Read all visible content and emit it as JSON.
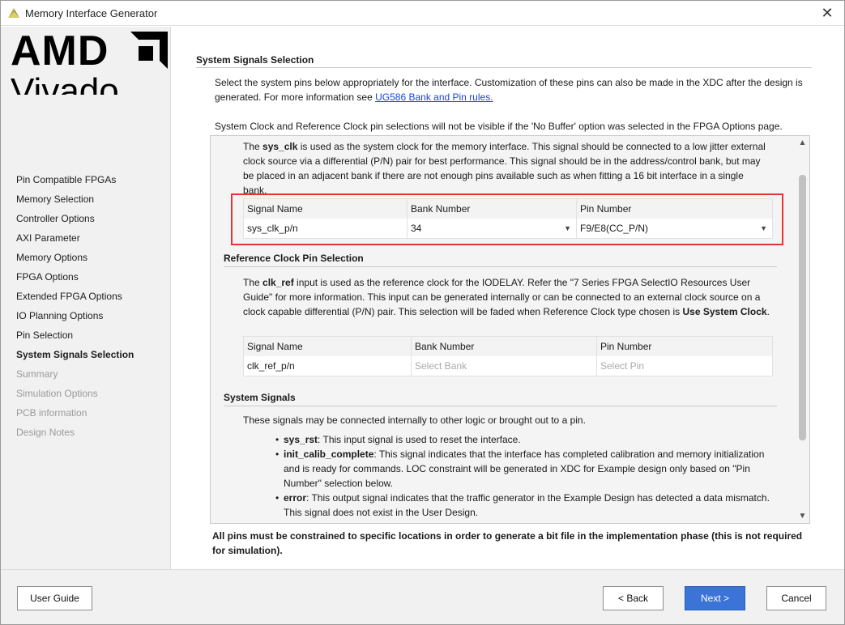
{
  "window": {
    "title": "Memory Interface Generator",
    "close_symbol": "✕"
  },
  "logo": {
    "brand": "AMD",
    "product": "Vivado"
  },
  "sidebar": {
    "steps": [
      {
        "label": "Pin Compatible FPGAs",
        "state": "normal"
      },
      {
        "label": "Memory Selection",
        "state": "normal"
      },
      {
        "label": "Controller Options",
        "state": "normal"
      },
      {
        "label": "AXI Parameter",
        "state": "normal"
      },
      {
        "label": "Memory Options",
        "state": "normal"
      },
      {
        "label": "FPGA Options",
        "state": "normal"
      },
      {
        "label": "Extended FPGA Options",
        "state": "normal"
      },
      {
        "label": "IO Planning Options",
        "state": "normal"
      },
      {
        "label": "Pin Selection",
        "state": "normal"
      },
      {
        "label": "System Signals Selection",
        "state": "active"
      },
      {
        "label": "Summary",
        "state": "disabled"
      },
      {
        "label": "Simulation Options",
        "state": "disabled"
      },
      {
        "label": "PCB information",
        "state": "disabled"
      },
      {
        "label": "Design Notes",
        "state": "disabled"
      }
    ]
  },
  "main": {
    "title": "System Signals Selection",
    "intro_text": "Select the system pins below appropriately for the interface. Customization of these pins can also be made in the XDC after the design is generated. For more information see",
    "intro_link": "UG586 Bank and Pin rules.",
    "note": "System Clock and Reference Clock pin selections will not be visible if the 'No Buffer' option was selected in the FPGA Options page.",
    "sys_clk": {
      "p1": "The ",
      "bold": "sys_clk",
      "p2": " is used as the system clock for the memory interface. This signal should be connected to a low jitter external clock source via a differential (P/N) pair for best performance. This signal should be in the address/control bank, but may be placed in an adjacent bank if there are not enough pins available such as when fitting a 16 bit interface in a single bank.",
      "headers": [
        "Signal Name",
        "Bank Number",
        "Pin Number"
      ],
      "row": {
        "signal": "sys_clk_p/n",
        "bank": "34",
        "pin": "F9/E8(CC_P/N)"
      }
    },
    "ref_clk": {
      "title": "Reference Clock Pin Selection",
      "p1": "The ",
      "bold": "clk_ref",
      "p2": " input is used as the reference clock for the IODELAY. Refer the \"7 Series FPGA SelectIO Resources User Guide\" for more information. This input can be generated internally or can be connected to an external clock source on a clock capable differential (P/N) pair. This selection will be faded when Reference Clock type chosen is ",
      "bold2": "Use System Clock",
      "p3": ".",
      "headers": [
        "Signal Name",
        "Bank Number",
        "Pin Number"
      ],
      "row": {
        "signal": "clk_ref_p/n",
        "bank": "Select Bank",
        "pin": "Select Pin"
      }
    },
    "system_signals": {
      "title": "System Signals",
      "desc": "These signals may be connected internally to other logic or brought out to a pin.",
      "items": [
        {
          "name": "sys_rst",
          "text": ": This input signal is used to reset the interface."
        },
        {
          "name": "init_calib_complete",
          "text": ": This signal indicates that the interface has completed calibration and memory initialization and is ready for commands. LOC constraint will be generated in XDC for Example design only based on \"Pin Number\" selection below."
        },
        {
          "name": "error",
          "text": ": This output signal indicates that the traffic generator in the Example Design has detected a data mismatch. This signal does not exist in the User Design."
        }
      ]
    },
    "footer_note": "All pins must be constrained to specific locations in order to generate a bit file in the implementation phase (this is not required for simulation)."
  },
  "buttons": {
    "user_guide": "User Guide",
    "back": "< Back",
    "next": "Next >",
    "cancel": "Cancel"
  },
  "icons": {
    "dropdown": "▼",
    "scroll_up": "▲",
    "scroll_down": "▼"
  },
  "colors": {
    "accent": "#3b73d6",
    "highlight_border": "#e63434",
    "link": "#1a44d8"
  }
}
